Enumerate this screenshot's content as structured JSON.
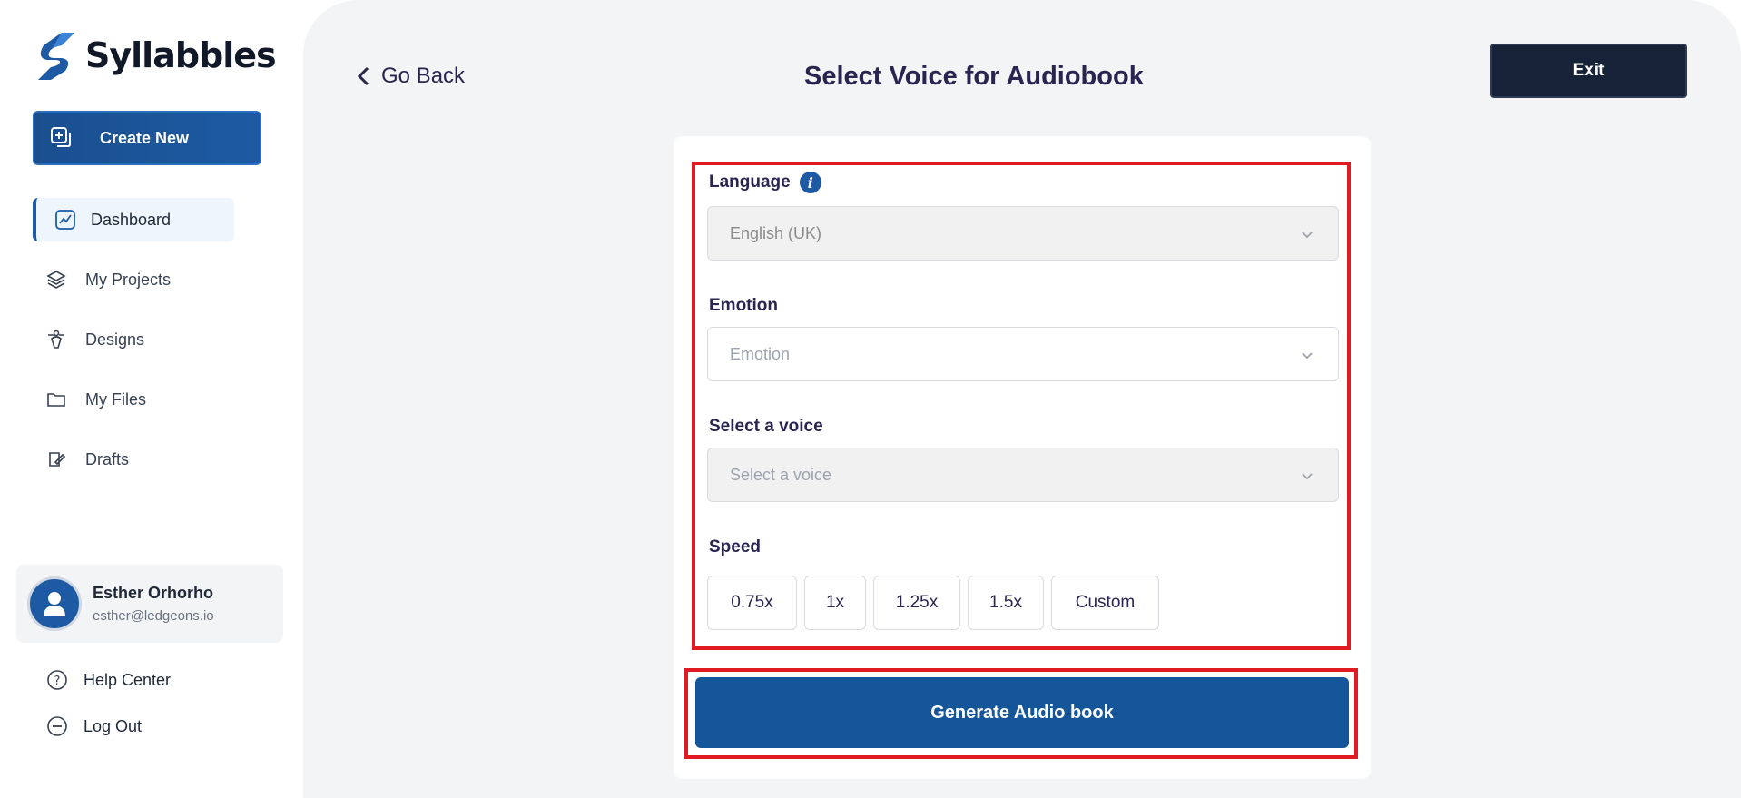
{
  "app": {
    "brand": "Syllabbles"
  },
  "sidebar": {
    "create_label": "Create New",
    "items": [
      {
        "label": "Dashboard",
        "icon": "chart-icon"
      },
      {
        "label": "My Projects",
        "icon": "layers-icon"
      },
      {
        "label": "Designs",
        "icon": "pen-tool-icon"
      },
      {
        "label": "My Files",
        "icon": "folder-icon"
      },
      {
        "label": "Drafts",
        "icon": "drafts-icon"
      }
    ],
    "user": {
      "name": "Esther Orhorho",
      "email": "esther@ledgeons.io"
    },
    "help_label": "Help Center",
    "logout_label": "Log Out"
  },
  "header": {
    "back_label": "Go Back",
    "title": "Select Voice for Audiobook",
    "exit_label": "Exit"
  },
  "form": {
    "language": {
      "label": "Language",
      "value": "English (UK)"
    },
    "emotion": {
      "label": "Emotion",
      "placeholder": "Emotion"
    },
    "voice": {
      "label": "Select a voice",
      "placeholder": "Select a voice"
    },
    "speed": {
      "label": "Speed",
      "options": [
        "0.75x",
        "1x",
        "1.25x",
        "1.5x",
        "Custom"
      ]
    },
    "submit_label": "Generate Audio book"
  },
  "colors": {
    "primary": "#15569a",
    "dark": "#152238",
    "highlight": "#e01b24"
  }
}
